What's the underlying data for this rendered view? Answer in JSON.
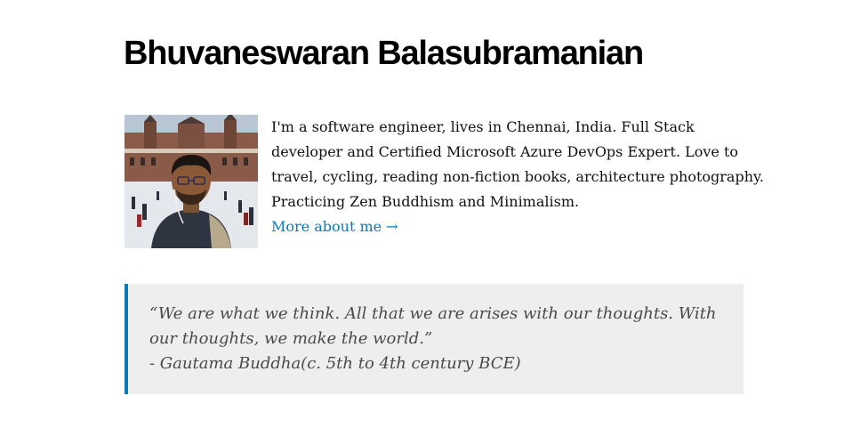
{
  "header": {
    "title": "Bhuvaneswaran Balasubramanian"
  },
  "profile": {
    "avatar_icon": "profile-photo",
    "bio": "I'm a software engineer, lives in Chennai, India. Full Stack developer and Certified Microsoft Azure DevOps Expert. Love to travel, cycling, reading non-fiction books, architecture photography. Practicing Zen Buddhism and Minimalism.",
    "more_link": "More about me →"
  },
  "quote": {
    "text": "“We are what we think. All that we are arises with our thoughts. With our thoughts, we make the world.”",
    "attribution": "- Gautama Buddha(c. 5th to 4th century BCE)"
  },
  "colors": {
    "accent": "#0a7bb8",
    "quote_background": "#eeeeee",
    "quote_text": "#4a4a4a"
  }
}
